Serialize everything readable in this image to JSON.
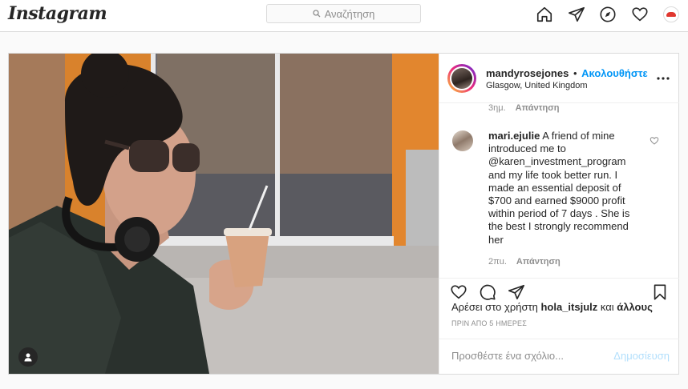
{
  "app": {
    "logo": "Instagram"
  },
  "search": {
    "placeholder": "Αναζήτηση"
  },
  "nav": {
    "icons": [
      "home-icon",
      "direct-icon",
      "explore-icon",
      "activity-heart-icon",
      "profile-avatar"
    ]
  },
  "post": {
    "username": "mandyrosejones",
    "dot": "•",
    "follow_label": "Ακολουθήστε",
    "location": "Glasgow, United Kingdom",
    "top_meta": {
      "age": "3ημ.",
      "reply": "Απάντηση"
    },
    "comment": {
      "username": "mari.ejulie",
      "text": "A friend of mine introduced me to @karen_investment_program and my life took better run. I made an essential deposit of $700 and earned $9000 profit within period of 7 days . She is the best I strongly recommend her",
      "age": "2πu.",
      "reply": "Απάντηση"
    },
    "likes": {
      "prefix": "Αρέσει στο χρήστη",
      "user": "hola_itsjulz",
      "joiner": "και",
      "others": "άλλους"
    },
    "time_ago": "ΠΡΙΝ ΑΠΟ 5 ΗΜΕΡΕΣ",
    "add_comment_placeholder": "Προσθέστε ένα σχόλιο...",
    "post_button": "Δημοσίευση"
  },
  "colors": {
    "link_blue": "#0095f6",
    "post_disabled": "#b2dffc",
    "border": "#dbdbdb"
  }
}
